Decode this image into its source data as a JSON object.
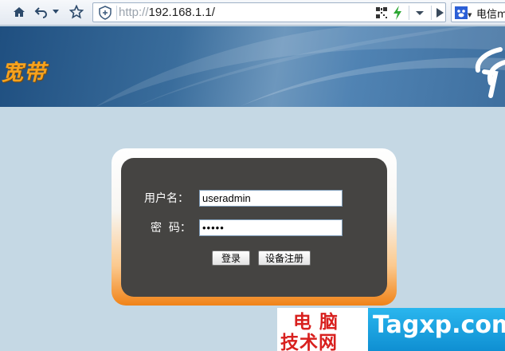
{
  "browser": {
    "url_scheme": "http://",
    "url_host": "192.168.1.1/",
    "search_text": "电信m"
  },
  "banner": {
    "title": "宽带"
  },
  "login": {
    "username_label": "用户名：",
    "username_value": "useradmin",
    "password_label": "密  码：",
    "password_value": "•••••",
    "login_button": "登录",
    "register_button": "设备注册"
  },
  "watermark": {
    "cn_line1": "电脑",
    "cn_line2": "技术网",
    "en": "Tagxp.com"
  },
  "colors": {
    "brand_orange": "#f08318",
    "panel_dark": "#454442",
    "page_bg": "#c5d8e4"
  }
}
